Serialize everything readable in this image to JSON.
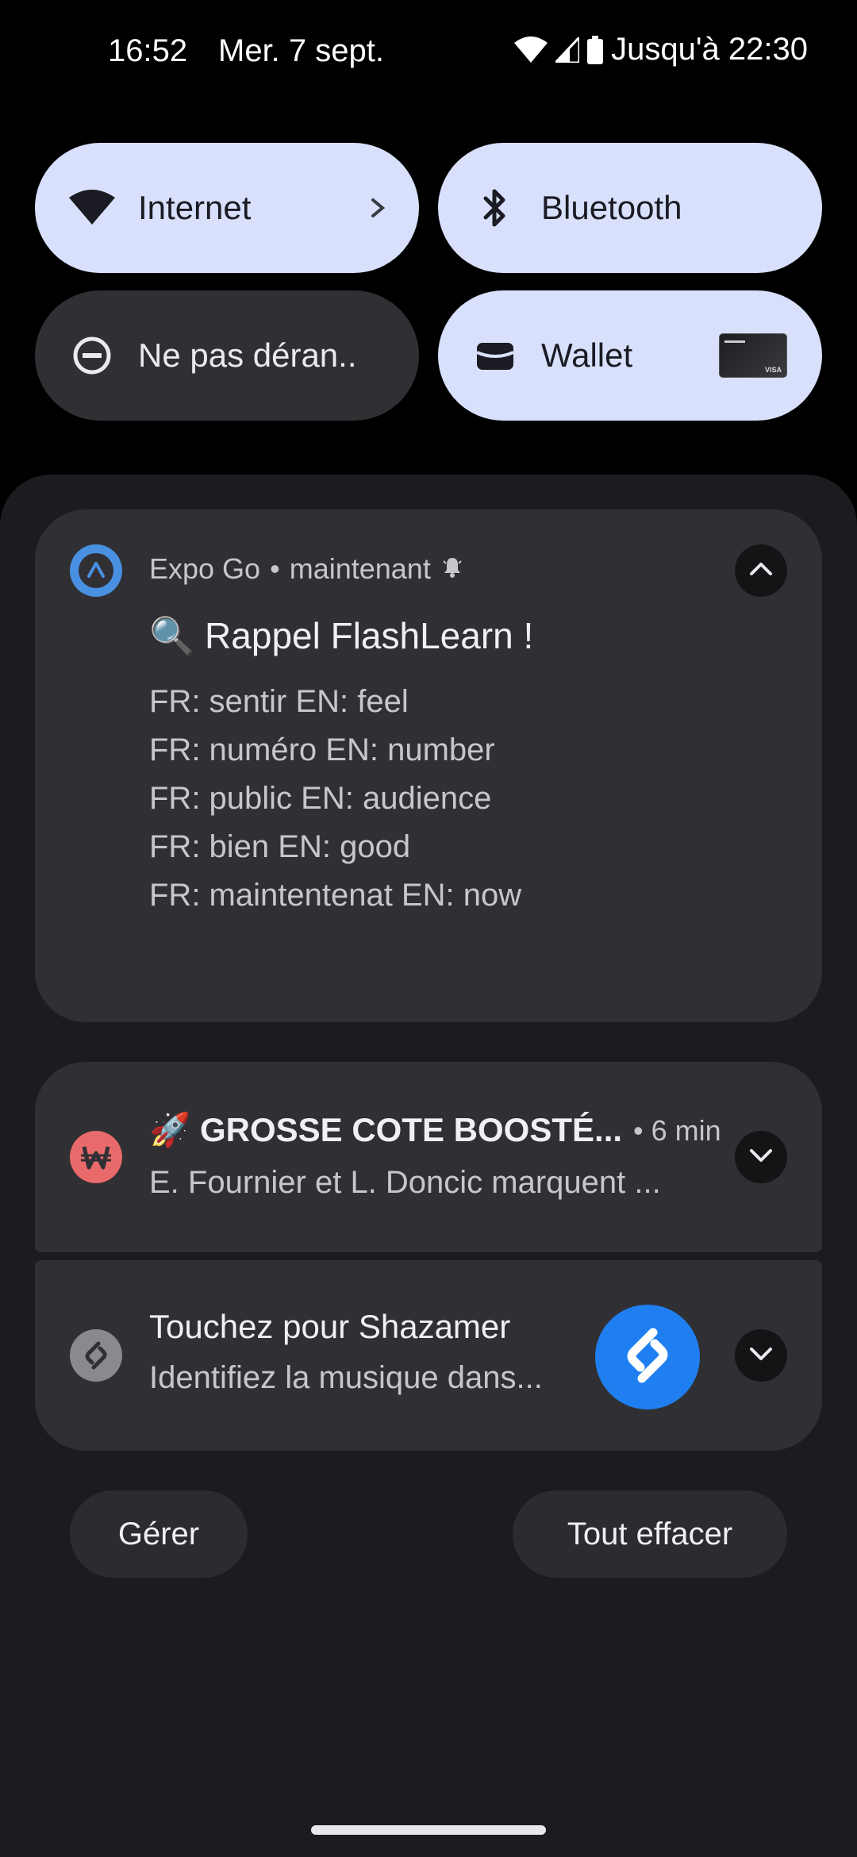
{
  "status_bar": {
    "time": "16:52",
    "date": "Mer. 7 sept.",
    "battery_text": "Jusqu'à 22:30",
    "icons": [
      "wifi-icon",
      "cell-signal-icon",
      "battery-icon"
    ]
  },
  "quick_settings": {
    "tiles": [
      {
        "label": "Internet",
        "icon": "wifi-icon",
        "state": "active"
      },
      {
        "label": "Bluetooth",
        "icon": "bluetooth-icon",
        "state": "active"
      },
      {
        "label": "Ne pas déran..",
        "icon": "do-not-disturb-icon",
        "state": "inactive"
      },
      {
        "label": "Wallet",
        "icon": "wallet-icon",
        "state": "active"
      }
    ]
  },
  "notifications": {
    "expo": {
      "app": "Expo Go",
      "separator": "•",
      "time": "maintenant",
      "title": "🔍 Rappel FlashLearn !",
      "lines": [
        "FR: sentir EN: feel",
        "FR: numéro EN: number",
        "FR: public EN: audience",
        "FR: bien EN: good",
        "FR: maintentenat EN: now"
      ]
    },
    "bet": {
      "title": "🚀 GROSSE COTE BOOSTÉ...",
      "time": "• 6 min",
      "text": "E. Fournier et L. Doncic marquent ..."
    },
    "shazam": {
      "title": "Touchez pour Shazamer",
      "text": "Identifiez la musique dans..."
    }
  },
  "actions": {
    "manage": "Gérer",
    "clear_all": "Tout effacer"
  },
  "colors": {
    "tile_active": "#d8e0fb",
    "tile_inactive": "#2f3034",
    "card_bg": "#303034",
    "shade_bg": "#1b1b20",
    "expo_blue": "#4a90e2",
    "bet_red": "#e86a6a",
    "shazam_blue": "#1f7ff0"
  }
}
